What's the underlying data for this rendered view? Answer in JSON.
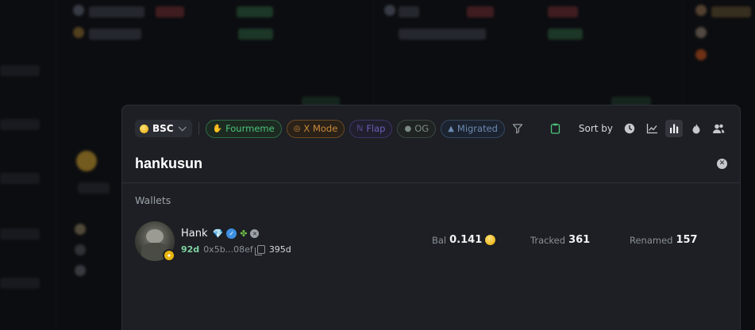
{
  "filters": {
    "chain": "BSC",
    "pills": [
      {
        "label": "Fourmeme",
        "icon": "hand-icon"
      },
      {
        "label": "X Mode",
        "icon": "target-icon"
      },
      {
        "label": "Flap",
        "icon": "flap-icon"
      },
      {
        "label": "OG",
        "icon": "drop-icon"
      },
      {
        "label": "Migrated",
        "icon": "graduation-cap-icon"
      }
    ],
    "sort_label": "Sort by"
  },
  "search": {
    "value": "hankusun"
  },
  "results": {
    "section_label": "Wallets",
    "wallet": {
      "name": "Hank",
      "age": "92d",
      "address": "0x5b...08ef",
      "days": "395d",
      "bal_label": "Bal",
      "bal_value": "0.141",
      "tracked_label": "Tracked",
      "tracked_value": "361",
      "renamed_label": "Renamed",
      "renamed_value": "157"
    }
  },
  "colors": {
    "accent_green": "#4cc37a",
    "bnb_gold": "#e6a800",
    "modal_bg": "#1d1f24"
  }
}
